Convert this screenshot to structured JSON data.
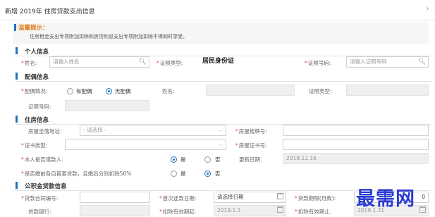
{
  "window": {
    "title": "新增 2019年 住房贷款支出信息",
    "close_symbol": "›"
  },
  "tip": {
    "title": "温馨提示：",
    "text": "住房租金支出专项附加扣除和房贷利息支出专项附加扣除不得同时享受。"
  },
  "personal": {
    "section_title": "个人信息",
    "name_label": "姓名:",
    "name_placeholder": "请输入姓名",
    "cert_type_label": "证照类型:",
    "cert_type_value": "居民身份证",
    "cert_no_label": "证照号码:",
    "cert_no_placeholder": "请输入证照号码"
  },
  "spouse": {
    "section_title": "配偶信息",
    "status_label": "配偶情况:",
    "option_yes": "有配偶",
    "option_no": "无配偶",
    "selected": "无配偶",
    "name_label": "姓名:",
    "cert_type_label": "证照类型:",
    "cert_no_label": "证照号码:"
  },
  "housing": {
    "section_title": "住房信息",
    "address_label": "房屋坐落地址:",
    "address_placeholder": "- 请选择 -",
    "building_no_label": "房屋楼牌号:",
    "cert_type_label": "证书类型:",
    "house_cert_no_label": "房屋证书号:",
    "borrower_label": "本人是否借款人:",
    "borrower_yes": "是",
    "borrower_no": "否",
    "borrower_selected": "是",
    "update_date_label": "更新日期:",
    "update_date_value": "2018.12.16",
    "premarital_label": "是否婚前各自首套贷款，且婚后分别扣除50%",
    "premarital_yes": "是",
    "premarital_no": "否",
    "premarital_selected": "否"
  },
  "loan": {
    "section_title": "公积金贷款信息",
    "contract_label": "贷款合同编号:",
    "first_repay_label": "首次还款日期:",
    "first_repay_placeholder": "请选择日期",
    "term_label": "贷款期限(月数):",
    "term_value": "0",
    "bank_label": "贷款银行:",
    "valid_from_label": "扣除有效期起:",
    "valid_from_value": "2019.1.1",
    "valid_to_label": "扣除有效期止:",
    "valid_to_value": "2019.1.31"
  },
  "watermark": "最需网",
  "colors": {
    "accent": "#1e73be",
    "required": "#e5474a",
    "tip": "#e07b1a",
    "watermark": "#2b3bd1"
  }
}
